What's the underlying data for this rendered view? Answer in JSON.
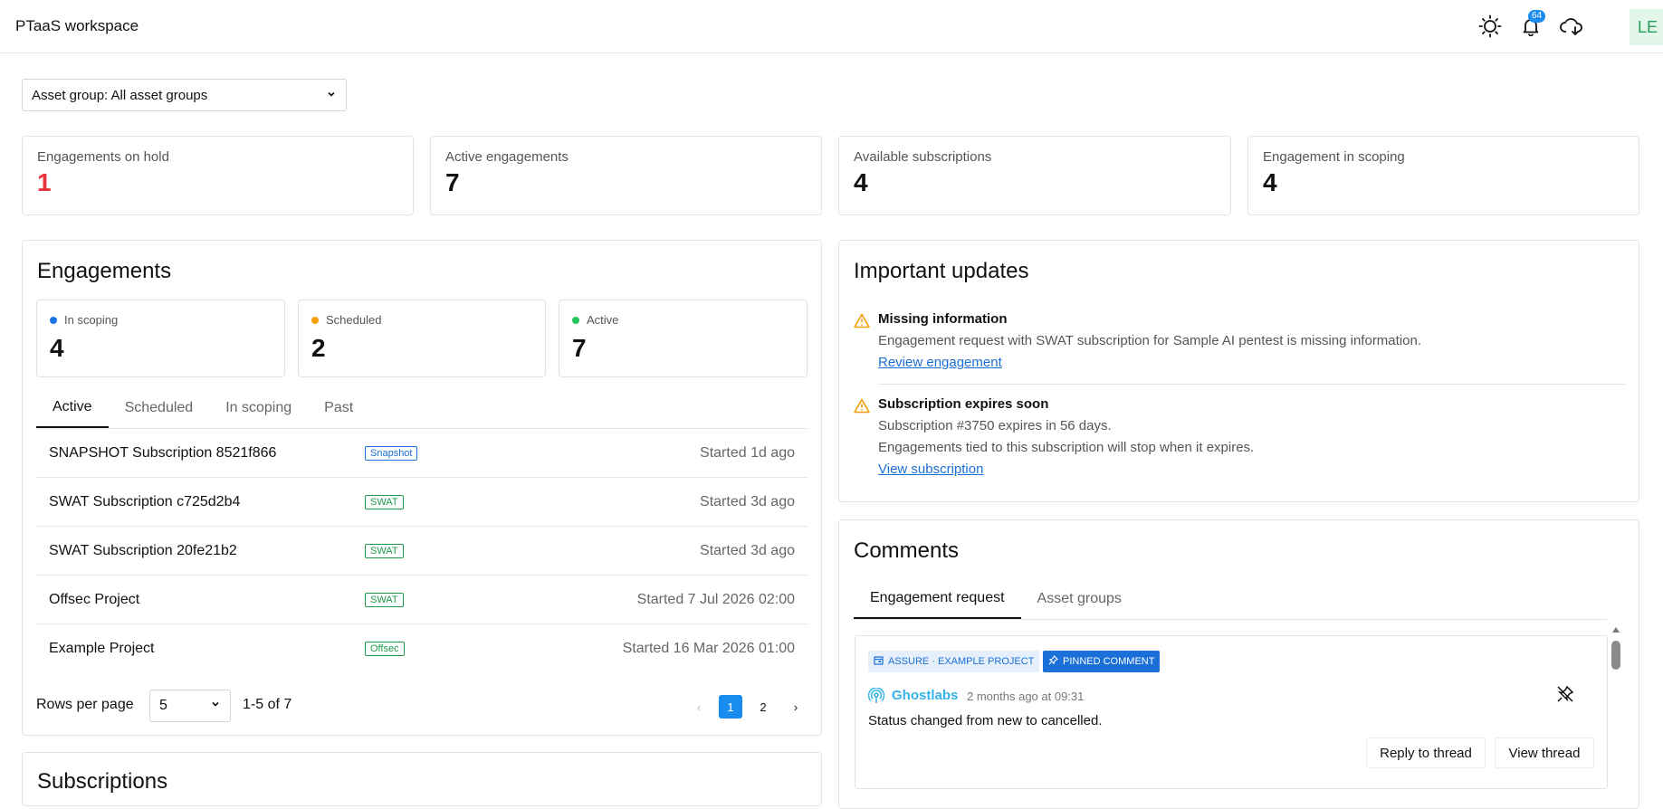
{
  "header": {
    "title": "PTaaS workspace",
    "notification_count": "64",
    "avatar_initials": "LE"
  },
  "asset_group": {
    "label": "Asset group: All asset groups"
  },
  "stats": [
    {
      "label": "Engagements on hold",
      "value": "1"
    },
    {
      "label": "Active engagements",
      "value": "7"
    },
    {
      "label": "Available subscriptions",
      "value": "4"
    },
    {
      "label": "Engagement in scoping",
      "value": "4"
    }
  ],
  "engagements": {
    "title": "Engagements",
    "summary": [
      {
        "label": "In scoping",
        "value": "4",
        "color": "#1a73e8"
      },
      {
        "label": "Scheduled",
        "value": "2",
        "color": "#f59e0b"
      },
      {
        "label": "Active",
        "value": "7",
        "color": "#22c55e"
      }
    ],
    "tabs": [
      "Active",
      "Scheduled",
      "In scoping",
      "Past"
    ],
    "rows": [
      {
        "name": "SNAPSHOT Subscription 8521f866",
        "tag": "Snapshot",
        "started": "Started 1d ago"
      },
      {
        "name": "SWAT Subscription c725d2b4",
        "tag": "SWAT",
        "started": "Started 3d ago"
      },
      {
        "name": "SWAT Subscription 20fe21b2",
        "tag": "SWAT",
        "started": "Started 3d ago"
      },
      {
        "name": "Offsec Project",
        "tag": "SWAT",
        "started": "Started 7 Jul 2026 02:00"
      },
      {
        "name": "Example Project",
        "tag": "Offsec",
        "started": "Started 16 Mar 2026 01:00"
      }
    ],
    "pagination": {
      "rows_label": "Rows per page",
      "rows_value": "5",
      "range": "1-5 of 7",
      "pages": [
        "1",
        "2"
      ]
    }
  },
  "subscriptions": {
    "title": "Subscriptions"
  },
  "updates": {
    "title": "Important updates",
    "items": [
      {
        "title": "Missing information",
        "lines": [
          "Engagement request with SWAT subscription for Sample AI pentest is missing information."
        ],
        "link": "Review engagement"
      },
      {
        "title": "Subscription expires soon",
        "lines": [
          "Subscription #3750 expires in 56 days.",
          "Engagements tied to this subscription will stop when it expires."
        ],
        "link": "View subscription"
      }
    ]
  },
  "comments": {
    "title": "Comments",
    "tabs": [
      "Engagement request",
      "Asset groups"
    ],
    "item": {
      "chip_context": "ASSURE · EXAMPLE PROJECT",
      "chip_pinned": "PINNED COMMENT",
      "author": "Ghostlabs",
      "time": "2 months ago at 09:31",
      "body": "Status changed from new to cancelled.",
      "reply_label": "Reply to thread",
      "view_label": "View thread"
    }
  }
}
